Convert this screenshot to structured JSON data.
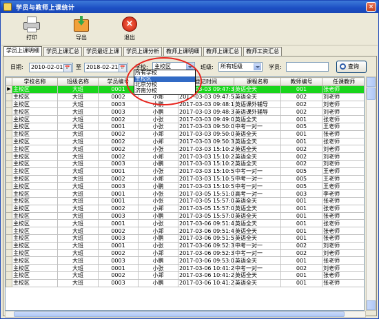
{
  "window": {
    "title": "学员与教师上课统计",
    "close_label": "×"
  },
  "toolbar": {
    "print_label": "打印",
    "export_label": "导出",
    "exit_label": "退出"
  },
  "tabs": [
    "学员上课明细",
    "学员上课汇总",
    "学员最近上课",
    "学员上课分析",
    "教师上课明细",
    "教师上课汇总",
    "教师工资汇总"
  ],
  "filters": {
    "date_label": "日期:",
    "date_from": "2010-02-01",
    "to_label": "至",
    "date_to": "2018-02-21",
    "school_label": "学校:",
    "school_value": "主校区",
    "class_label": "班级:",
    "class_value": "所有班级",
    "student_label": "学员:",
    "student_value": "",
    "query_label": "查询",
    "calendar_glyph": "📅"
  },
  "school_options": [
    "所有学校",
    "主校区",
    "北京分校",
    "济南分校"
  ],
  "school_selected_index": 1,
  "grid": {
    "columns": [
      "学校名称",
      "班级名称",
      "学员编号",
      "学员姓名",
      "登记时间",
      "课程名称",
      "教师编号",
      "任课教师"
    ],
    "rows": [
      [
        "主校区",
        "大班",
        "0001",
        "小张",
        "2017-03-03 09:47:31",
        "英语全天",
        "001",
        "张老师"
      ],
      [
        "主校区",
        "大班",
        "0002",
        "小郑",
        "2017-03-03 09:47:52",
        "英语全天",
        "002",
        "刘老师"
      ],
      [
        "主校区",
        "大班",
        "0003",
        "小鹏",
        "2017-03-03 09:48:19",
        "英语课外辅导",
        "002",
        "刘老师"
      ],
      [
        "主校区",
        "大班",
        "0003",
        "小鹏",
        "2017-03-03 09:48:36",
        "英语课外辅导",
        "002",
        "刘老师"
      ],
      [
        "主校区",
        "大班",
        "0002",
        "小张",
        "2017-03-03 09:49:00",
        "英语全天",
        "001",
        "张老师"
      ],
      [
        "主校区",
        "大班",
        "0001",
        "小张",
        "2017-03-03 09:50:00",
        "中考一对一",
        "005",
        "王老师"
      ],
      [
        "主校区",
        "大班",
        "0002",
        "小郑",
        "2017-03-03 09:50:08",
        "英语全天",
        "001",
        "张老师"
      ],
      [
        "主校区",
        "大班",
        "0002",
        "小郑",
        "2017-03-03 09:50:36",
        "英语全天",
        "001",
        "张老师"
      ],
      [
        "主校区",
        "大班",
        "0002",
        "小张",
        "2017-03-03 15:10:27",
        "英语全天",
        "002",
        "刘老师"
      ],
      [
        "主校区",
        "大班",
        "0002",
        "小郑",
        "2017-03-03 15:10:27",
        "英语全天",
        "002",
        "刘老师"
      ],
      [
        "主校区",
        "大班",
        "0003",
        "小鹏",
        "2017-03-03 15:10:27",
        "英语全天",
        "002",
        "刘老师"
      ],
      [
        "主校区",
        "大班",
        "0001",
        "小张",
        "2017-03-03 15:10:58",
        "中考一对一",
        "005",
        "王老师"
      ],
      [
        "主校区",
        "大班",
        "0002",
        "小郑",
        "2017-03-03 15:10:58",
        "中考一对一",
        "005",
        "王老师"
      ],
      [
        "主校区",
        "大班",
        "0003",
        "小鹏",
        "2017-03-03 15:10:58",
        "中考一对一",
        "005",
        "王老师"
      ],
      [
        "主校区",
        "大班",
        "0001",
        "小张",
        "2017-03-05 15:51:05",
        "高考一对一",
        "003",
        "李老师"
      ],
      [
        "主校区",
        "大班",
        "0001",
        "小张",
        "2017-03-05 15:57:00",
        "英语全天",
        "001",
        "张老师"
      ],
      [
        "主校区",
        "大班",
        "0002",
        "小郑",
        "2017-03-05 15:57:00",
        "英语全天",
        "001",
        "张老师"
      ],
      [
        "主校区",
        "大班",
        "0003",
        "小鹏",
        "2017-03-05 15:57:00",
        "英语全天",
        "001",
        "张老师"
      ],
      [
        "主校区",
        "大班",
        "0001",
        "小张",
        "2017-03-06 09:51:40",
        "英语全天",
        "001",
        "张老师"
      ],
      [
        "主校区",
        "大班",
        "0002",
        "小郑",
        "2017-03-06 09:51:40",
        "英语全天",
        "001",
        "张老师"
      ],
      [
        "主校区",
        "大班",
        "0003",
        "小鹏",
        "2017-03-06 09:51:53",
        "英语全天",
        "001",
        "张老师"
      ],
      [
        "主校区",
        "大班",
        "0001",
        "小张",
        "2017-03-06 09:52:30",
        "中考一对一",
        "002",
        "刘老师"
      ],
      [
        "主校区",
        "大班",
        "0002",
        "小郑",
        "2017-03-06 09:52:30",
        "中考一对一",
        "002",
        "刘老师"
      ],
      [
        "主校区",
        "大班",
        "0003",
        "小鹏",
        "2017-03-06 09:53:06",
        "英语全天",
        "001",
        "张老师"
      ],
      [
        "主校区",
        "大班",
        "0001",
        "小张",
        "2017-03-06 10:41:22",
        "中考一对一",
        "002",
        "刘老师"
      ],
      [
        "主校区",
        "大班",
        "0002",
        "小郑",
        "2017-03-06 10:41:22",
        "英语全天",
        "001",
        "张老师"
      ],
      [
        "主校区",
        "大班",
        "0003",
        "小鹏",
        "2017-03-06 10:41:22",
        "英语全天",
        "001",
        "张老师"
      ]
    ],
    "highlight_row": 0,
    "row_pointer": "▶"
  },
  "colors": {
    "highlight": "#19d51c",
    "annotation_circle": "#e8231c",
    "selection": "#316ac5"
  }
}
